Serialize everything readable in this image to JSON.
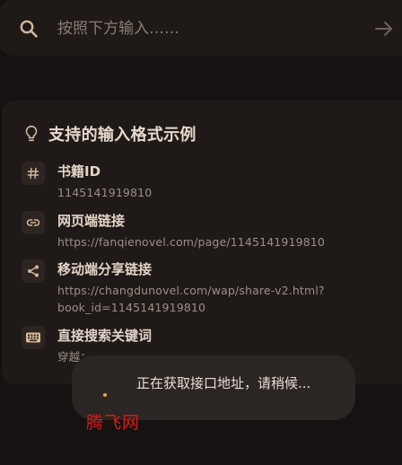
{
  "search": {
    "placeholder": "按照下方输入……",
    "icon": "search-icon",
    "submit_icon": "arrow-right-icon"
  },
  "formats_card": {
    "title": "支持的输入格式示例",
    "icon": "lightbulb-icon",
    "items": [
      {
        "icon": "hash-icon",
        "title": "书籍ID",
        "example": "1145141919810"
      },
      {
        "icon": "link-icon",
        "title": "网页端链接",
        "example": "https://fanqienovel.com/page/1145141919810"
      },
      {
        "icon": "share-icon",
        "title": "移动端分享链接",
        "example": "https://changdunovel.com/wap/share-v2.html?\nbook_id=1145141919810"
      },
      {
        "icon": "keyboard-icon",
        "title": "直接搜索关键词",
        "example": "穿越："
      }
    ]
  },
  "toast": {
    "message": "正在获取接口地址，请稍候..."
  },
  "watermark": {
    "text": "腾飞网"
  },
  "colors": {
    "background": "#161211",
    "surface": "#1f1a18",
    "icon_box": "#2d2521",
    "icon_tint": "#d7b89a",
    "toast": "#2b2523",
    "watermark": "#d81a1a"
  }
}
